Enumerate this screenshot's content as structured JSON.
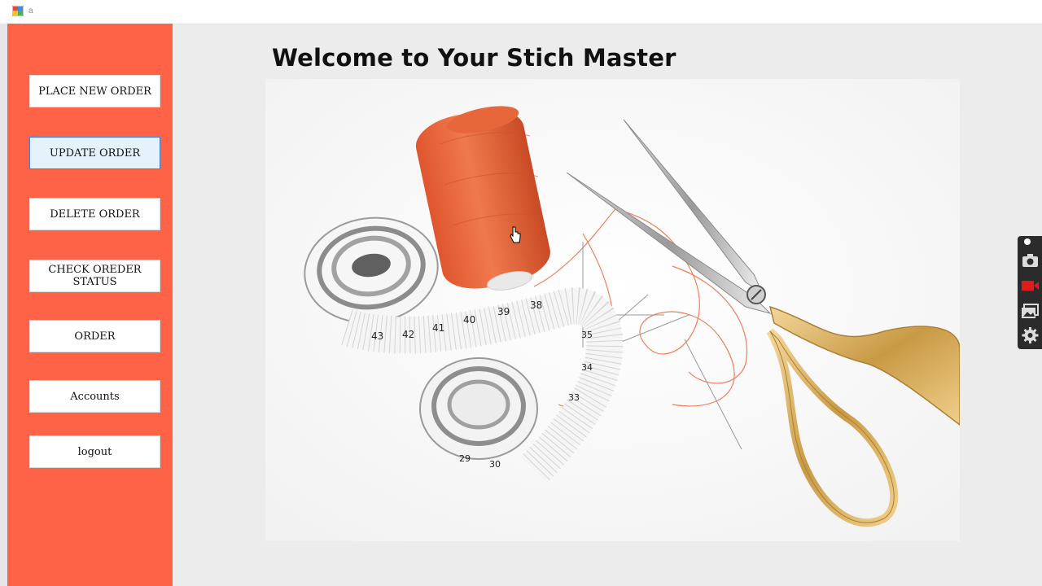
{
  "window": {
    "title": "a"
  },
  "sidebar": {
    "buttons": [
      {
        "label": "PLACE NEW ORDER"
      },
      {
        "label": "UPDATE ORDER"
      },
      {
        "label": "DELETE ORDER"
      },
      {
        "label": "CHECK OREDER STATUS"
      },
      {
        "label": "ORDER"
      },
      {
        "label": "Accounts"
      },
      {
        "label": "logout"
      }
    ]
  },
  "main": {
    "title": "Welcome to Your Stich Master",
    "tape_numbers": [
      "43",
      "42",
      "41",
      "40",
      "39",
      "38",
      "35",
      "34",
      "33",
      "29",
      "30"
    ]
  },
  "capture_toolbar": {
    "icons": [
      "pin-icon",
      "camera-icon",
      "video-record-icon",
      "gallery-icon",
      "gear-icon"
    ]
  },
  "colors": {
    "sidebar": "#ff6347",
    "thread": "#ee6a3c",
    "active_button_bg": "#e5f1fb",
    "active_button_border": "#3c7fd6"
  }
}
